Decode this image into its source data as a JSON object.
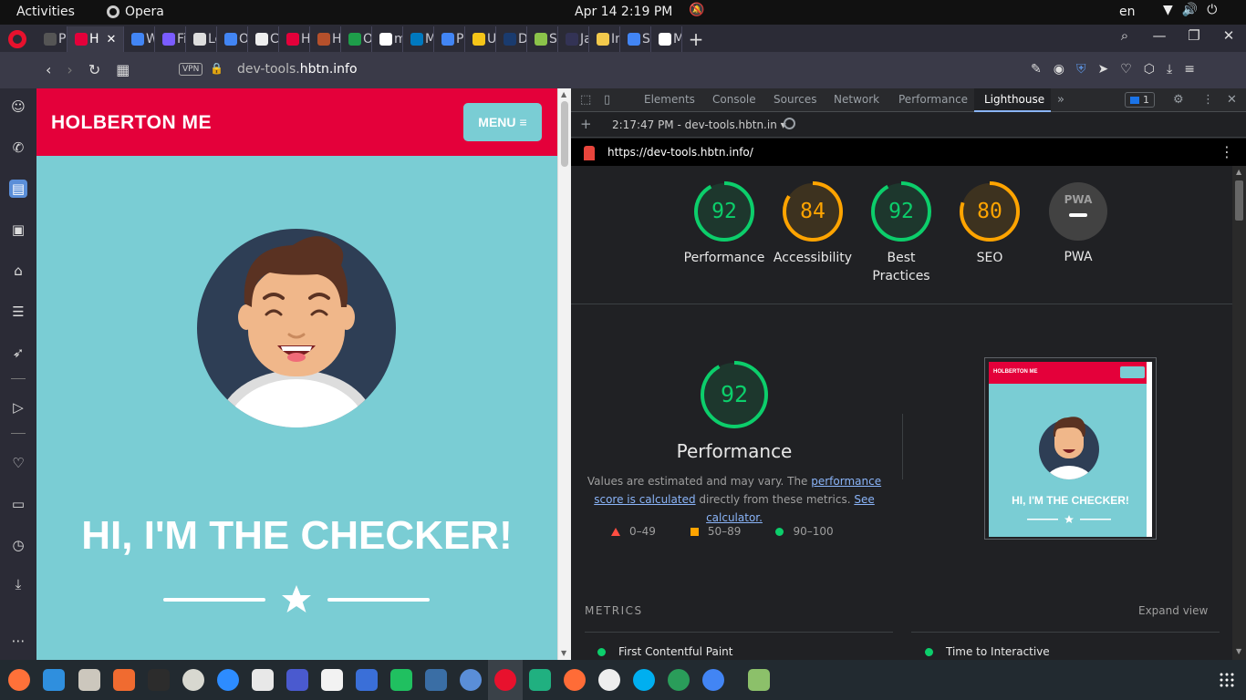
{
  "system_bar": {
    "activities": "Activities",
    "app_name": "Opera",
    "clock": "Apr 14  2:19 PM",
    "language": "en"
  },
  "browser": {
    "tabs": [
      {
        "label": "Pr",
        "color": "#555555"
      },
      {
        "label": "H",
        "color": "#e4003a",
        "active": true
      },
      {
        "label": "W",
        "color": "#4285f4"
      },
      {
        "label": "Fi",
        "color": "#7a5cff"
      },
      {
        "label": "Lo",
        "color": "#dddddd"
      },
      {
        "label": "Ov",
        "color": "#4285f4"
      },
      {
        "label": "Ca",
        "color": "#eeeeee"
      },
      {
        "label": "Ho",
        "color": "#e4003a"
      },
      {
        "label": "Ho",
        "color": "#b5502b"
      },
      {
        "label": "Op",
        "color": "#1e9e4a"
      },
      {
        "label": "mi",
        "color": "#ffffff"
      },
      {
        "label": "My",
        "color": "#0079bf"
      },
      {
        "label": "Pr",
        "color": "#4285f4"
      },
      {
        "label": "Un",
        "color": "#f5c518"
      },
      {
        "label": "De",
        "color": "#1a3b6e"
      },
      {
        "label": "Stu",
        "color": "#8bc34a"
      },
      {
        "label": "Jav",
        "color": "#333355"
      },
      {
        "label": "Int",
        "color": "#f2c94c"
      },
      {
        "label": "So",
        "color": "#4285f4"
      },
      {
        "label": "Ma",
        "color": "#ffffff"
      }
    ],
    "active_tab_close": "✕",
    "new_tab": "+",
    "address": {
      "vpn_label": "VPN",
      "url_prefix": "dev-tools.",
      "url_domain": "hbtn.info"
    }
  },
  "website": {
    "title": "HOLBERTON ME",
    "menu_label": "MENU",
    "hero_text": "HI, I'M THE CHECKER!"
  },
  "devtools": {
    "tabs": [
      "Elements",
      "Console",
      "Sources",
      "Network",
      "Performance",
      "Lighthouse"
    ],
    "active_tab": "Lighthouse",
    "issues_count": "1",
    "report_select": "2:17:47 PM - dev-tools.hbtn.in",
    "report_url": "https://dev-tools.hbtn.info/",
    "gauges": [
      {
        "score": 92,
        "label": "Performance",
        "color": "#0cce6b"
      },
      {
        "score": 84,
        "label": "Accessibility",
        "color": "#ffa400"
      },
      {
        "score": 92,
        "label": "Best Practices",
        "color": "#0cce6b"
      },
      {
        "score": 80,
        "label": "SEO",
        "color": "#ffa400"
      },
      {
        "score": null,
        "label": "PWA",
        "badge": "PWA"
      }
    ],
    "performance": {
      "score": 92,
      "title": "Performance",
      "desc_pre": "Values are estimated and may vary. The ",
      "desc_link1": "performance score is calculated",
      "desc_mid": " directly from these metrics. ",
      "desc_link2": "See calculator.",
      "legend": [
        "0–49",
        "50–89",
        "90–100"
      ],
      "screenshot_title": "HOLBERTON ME",
      "screenshot_hero": "HI, I'M THE CHECKER!"
    },
    "metrics": {
      "heading": "METRICS",
      "expand": "Expand view",
      "items": [
        "First Contentful Paint",
        "Time to Interactive"
      ]
    }
  },
  "colors": {
    "site_red": "#e4003a",
    "site_teal": "#7acdd4",
    "lh_pass": "#0cce6b",
    "lh_average": "#ffa400",
    "lh_fail": "#ff4e42"
  }
}
